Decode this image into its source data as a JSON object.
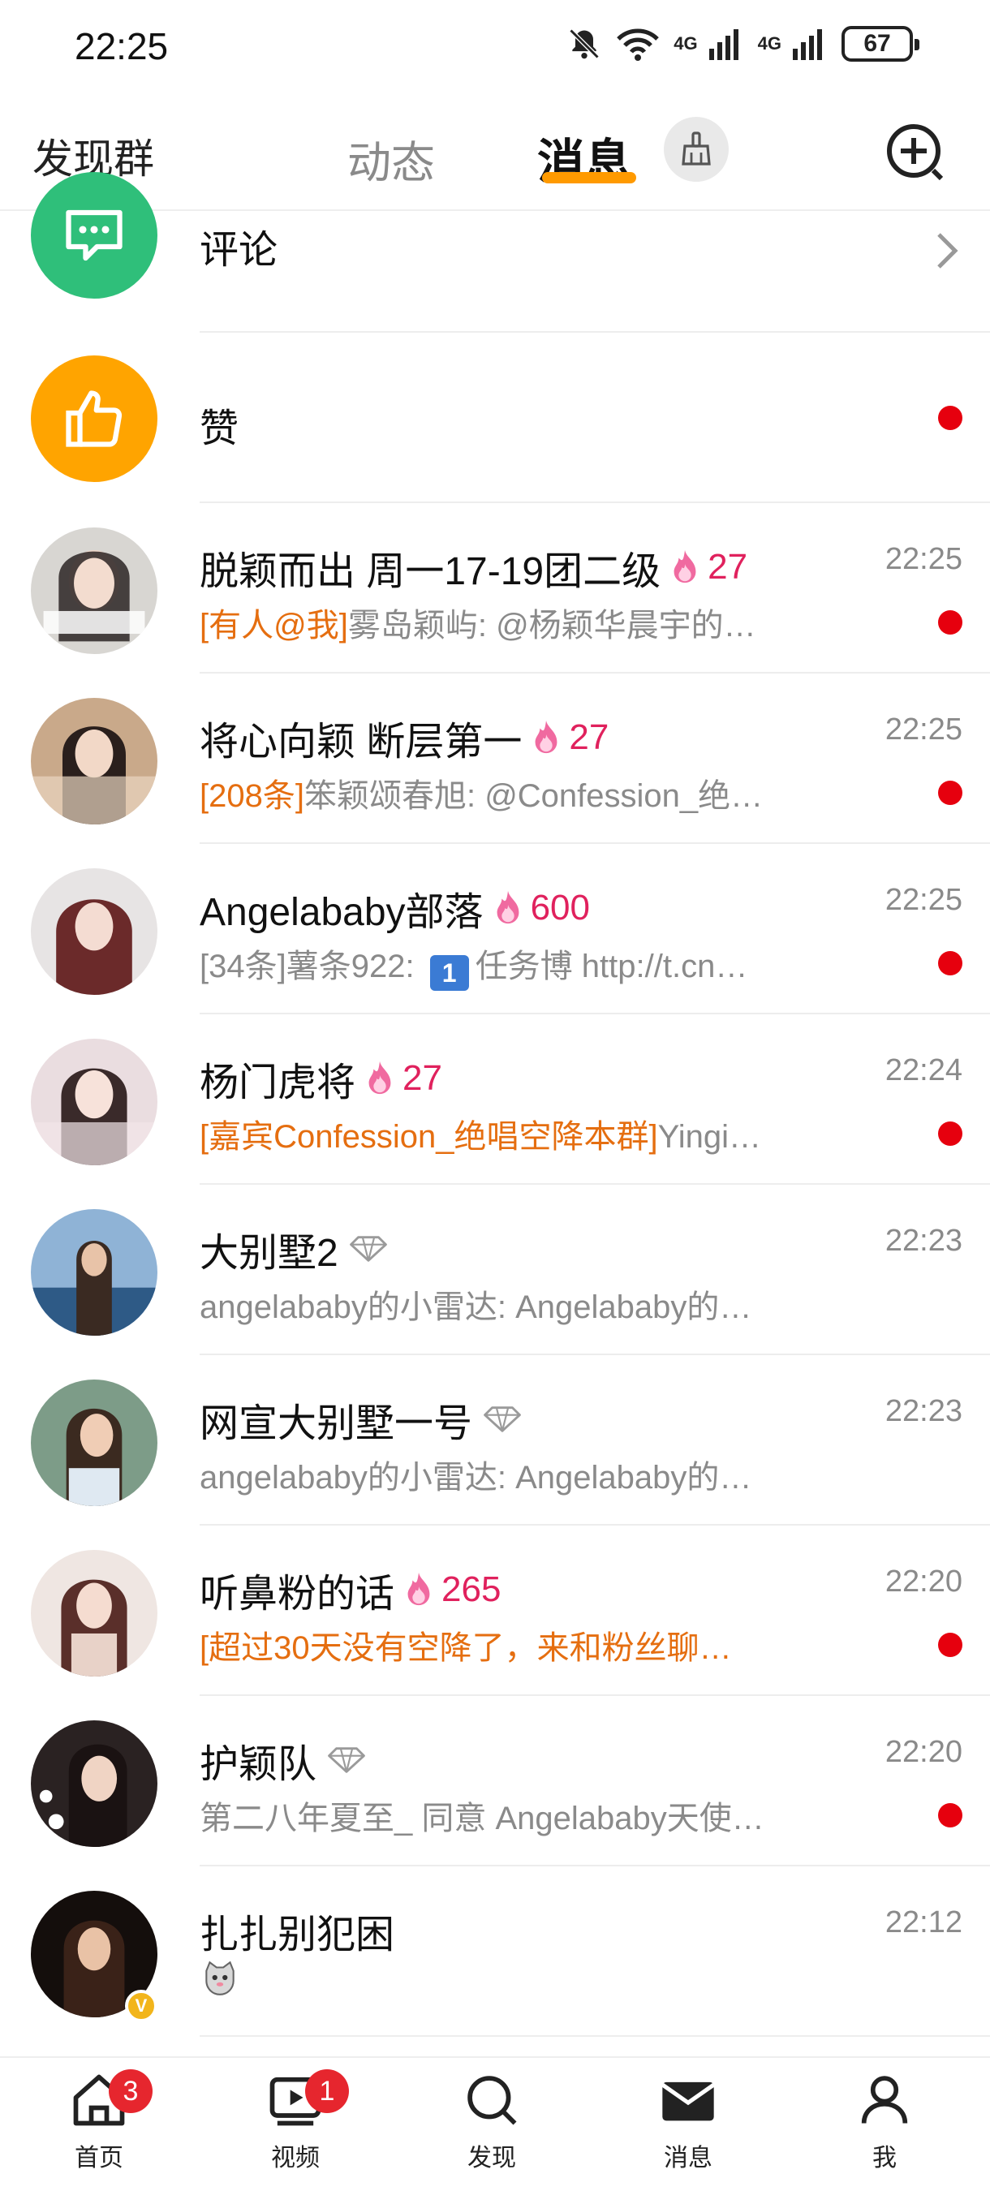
{
  "status_bar": {
    "time": "22:25",
    "network1": "4G",
    "network2": "4G",
    "battery": "67"
  },
  "header": {
    "discover_group": "发现群",
    "tab_dynamic": "动态",
    "tab_messages": "消息"
  },
  "colors": {
    "accent": "#ff9a00",
    "unread": "#e6000e",
    "highlight": "#e56e10",
    "heat": "#e0215d",
    "comment_green": "#2fbf7a",
    "like_orange": "#ffa400"
  },
  "special_rows": [
    {
      "label": "评论",
      "icon": "comment-icon"
    },
    {
      "label": "赞",
      "icon": "thumbs-up-icon"
    }
  ],
  "chats": [
    {
      "name": "脱颖而出 周一17-19团二级",
      "heat": "27",
      "time": "22:25",
      "highlight": "[有人@我]",
      "preview": "雾岛颖屿: @杨颖华晨宇的…",
      "unread": true
    },
    {
      "name": "将心向颖 断层第一",
      "heat": "27",
      "time": "22:25",
      "highlight": "[208条]",
      "preview": "笨颖颂春旭: @Confession_绝…",
      "unread": true
    },
    {
      "name": "Angelababy部落",
      "heat": "600",
      "time": "22:25",
      "highlight": "",
      "preview_a": "[34条]薯条922: ",
      "badge": "1",
      "preview_b": "任务博 http://t.cn…",
      "unread": true
    },
    {
      "name": "杨门虎将",
      "heat": "27",
      "time": "22:24",
      "highlight": "[嘉宾Confession_绝唱空降本群]",
      "preview": "Yingi…",
      "unread": true
    },
    {
      "name": "大别墅2",
      "time": "22:23",
      "preview": "angelababy的小雷达: Angelababy的…",
      "unread": false
    },
    {
      "name": "网宣大别墅一号",
      "time": "22:23",
      "preview": "angelababy的小雷达: Angelababy的…",
      "unread": false
    },
    {
      "name": "听鼻粉的话",
      "heat": "265",
      "time": "22:20",
      "highlight": "[超过30天没有空降了，来和粉丝聊…",
      "preview": "",
      "unread": true
    },
    {
      "name": "护颖队",
      "time": "22:20",
      "preview": "第二八年夏至_ 同意 Angelababy天使…",
      "unread": true
    },
    {
      "name": "扎扎别犯困",
      "time": "22:12",
      "preview": "",
      "unread": false,
      "verified_mark": "V"
    }
  ],
  "bottom_nav": [
    {
      "label": "首页",
      "badge": "3"
    },
    {
      "label": "视频",
      "badge": "1"
    },
    {
      "label": "发现"
    },
    {
      "label": "消息"
    },
    {
      "label": "我"
    }
  ]
}
